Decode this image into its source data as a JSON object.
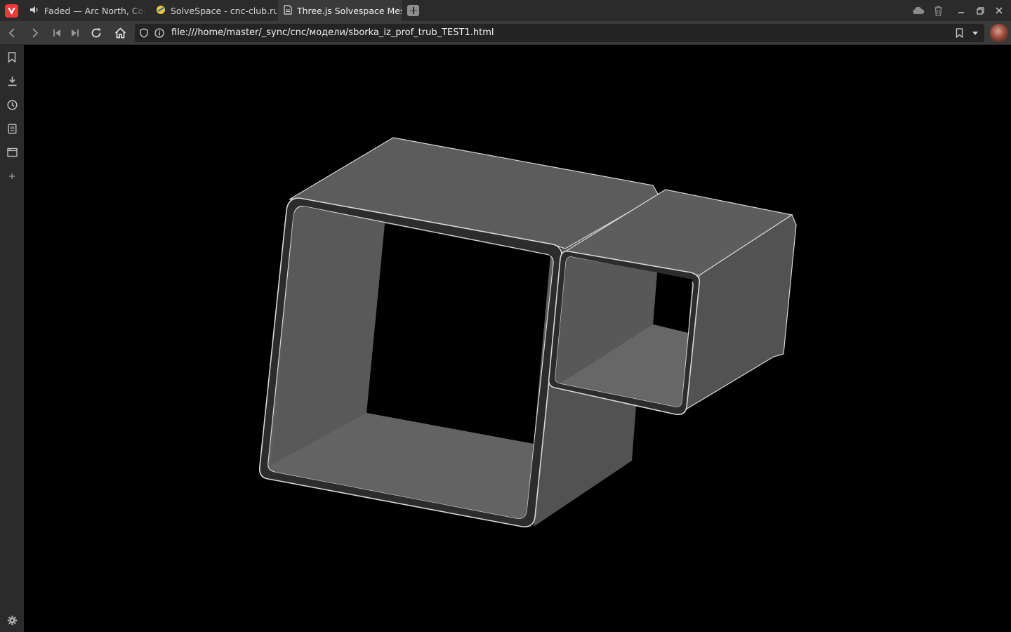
{
  "tabs": [
    {
      "label": "Faded — Arc North, Cour, Krista Marina",
      "icon": "speaker-icon"
    },
    {
      "label": "SolveSpace - cnc-club.ru",
      "icon": "site-favicon"
    },
    {
      "label": "Three.js Solvespace Mesh",
      "icon": "document-icon",
      "active": true
    }
  ],
  "address": {
    "url": "file:///home/master/_sync/cnc/модели/sborka_iz_prof_trub_TEST1.html"
  },
  "side_panel": [
    "bookmarks-icon",
    "downloads-icon",
    "history-icon",
    "notes-icon",
    "window-icon",
    "add-panel-icon",
    "settings-icon"
  ],
  "canvas": {
    "background": "#000000",
    "mesh_color": "#5f5f5f",
    "edge_color": "#d8d8d8",
    "scene": "two rectangular profile tubes (Solvespace mesh, Three.js)"
  },
  "colors": {
    "tabbar": "#2b2b2b",
    "toolbar": "#3a3a3a",
    "accent": "#ef3939"
  }
}
